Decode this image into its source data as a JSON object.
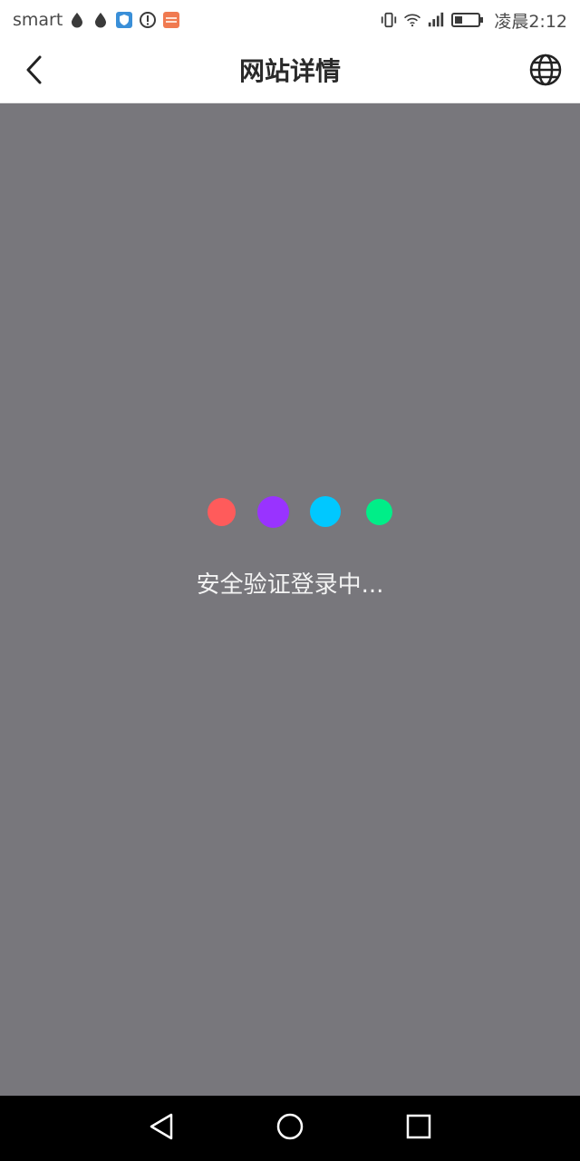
{
  "status_bar": {
    "carrier": "smart",
    "time": "凌晨2:12",
    "icons": [
      "drop-icon",
      "drop-icon",
      "shield-app-icon",
      "alert-icon",
      "app-badge-icon",
      "vibrate-icon",
      "wifi-icon",
      "signal-icon",
      "battery-icon"
    ]
  },
  "header": {
    "title": "网站详情",
    "back_icon": "back-chevron-icon",
    "globe_icon": "globe-icon"
  },
  "main": {
    "loading_text": "安全验证登录中...",
    "dots": [
      {
        "color": "#ff5b5b"
      },
      {
        "color": "#9933ff"
      },
      {
        "color": "#00c8ff"
      },
      {
        "color": "#00ee88"
      }
    ],
    "background": "#78777c"
  },
  "nav_bar": {
    "buttons": [
      "back-triangle-icon",
      "home-circle-icon",
      "recents-square-icon"
    ]
  }
}
